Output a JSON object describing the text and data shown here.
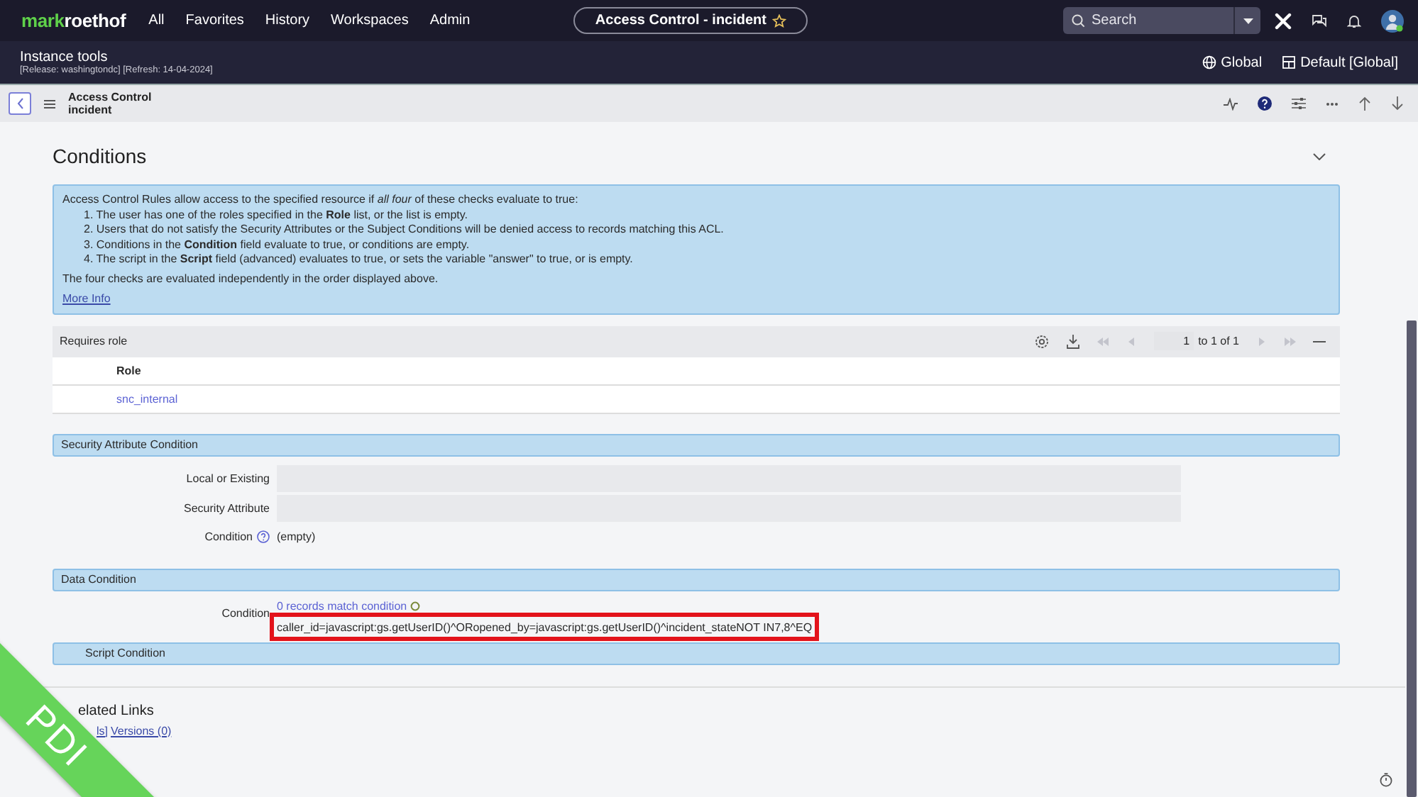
{
  "nav": {
    "logo": {
      "part_1": "mark",
      "part_2": "roethof"
    },
    "menu": [
      {
        "label": "All"
      },
      {
        "label": "Favorites"
      },
      {
        "label": "History"
      },
      {
        "label": "Workspaces"
      },
      {
        "label": "Admin"
      }
    ],
    "record_pill": "Access Control - incident",
    "search": {
      "placeholder": "Search"
    }
  },
  "instance_bar": {
    "title": "Instance tools",
    "details": "[Release: washingtondc] [Refresh: 14-04-2024]",
    "scope": "Global",
    "application": "Default [Global]"
  },
  "form_header": {
    "title": "Access Control",
    "subtitle": "incident"
  },
  "section": {
    "title": "Conditions"
  },
  "info_box": {
    "intro": "Access Control Rules allow access to the specified resource if *all four* of these checks evaluate to true:",
    "items": [
      "1. The user has one of the roles specified in the **Role** list, or the list is empty.",
      "2. Users that do not satisfy the Security Attributes or the Subject Conditions will be denied access to records matching this ACL.",
      "3. Conditions in the **Condition** field evaluate to true, or conditions are empty.",
      "4. The script in the **Script** field (advanced) evaluates to true, or sets the variable \"answer\" to true, or is empty."
    ],
    "note": "The four checks are evaluated independently in the order displayed above.",
    "link": "More Info"
  },
  "related_list": {
    "title": "Requires role",
    "page": "1",
    "range": "to 1 of 1",
    "pager": [
      {
        "kind": "first",
        "disabled": true
      },
      {
        "kind": "prev",
        "disabled": true
      },
      {
        "kind": "next",
        "disabled": true
      },
      {
        "kind": "last",
        "disabled": true
      }
    ],
    "columns": [
      "Role"
    ],
    "rows": [
      [
        "snc_internal"
      ]
    ]
  },
  "security_attribute_condition": {
    "title": "Security Attribute Condition",
    "fields": [
      {
        "kind": "input",
        "label": "Local or Existing"
      },
      {
        "kind": "input",
        "label": "Security Attribute"
      },
      {
        "kind": "text",
        "label": "Condition",
        "help": true,
        "value": "(empty)"
      }
    ]
  },
  "data_condition": {
    "title": "Data Condition",
    "label": "Condition",
    "match_link": "0 records match condition",
    "query": "caller_id=javascript:gs.getUserID()^ORopened_by=javascript:gs.getUserID()^incident_stateNOT IN7,8^EQ",
    "highlighted": true
  },
  "script_condition": {
    "title": "Script Condition"
  },
  "related_links": {
    "title": "elated Links",
    "items": [
      "ls]",
      "Versions (0)"
    ]
  },
  "ribbon": {
    "label": "PDI"
  }
}
